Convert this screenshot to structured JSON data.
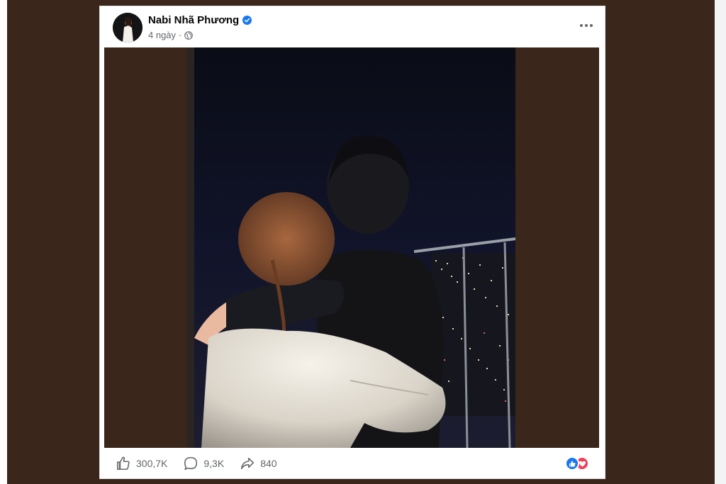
{
  "post": {
    "author": "Nabi Nhã Phương",
    "time": "4 ngày",
    "separator": "·",
    "verified": true,
    "privacy_icon": "globe-icon"
  },
  "stats": {
    "likes": "300,7K",
    "comments": "9,3K",
    "shares": "840"
  },
  "reactions": [
    "like",
    "love"
  ],
  "colors": {
    "background": "#3a261b",
    "verified": "#1877f2",
    "like": "#1877f2",
    "love": "#f33e58",
    "text_secondary": "#65676b"
  }
}
